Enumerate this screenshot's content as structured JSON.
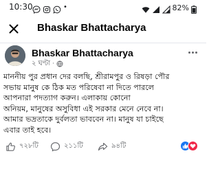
{
  "status_bar": {
    "time": "10:30",
    "separator": "•",
    "battery": "82%"
  },
  "app_bar": {
    "title": "Bhaskar Bhattacharya"
  },
  "post": {
    "author": "Bhaskar Bhattacharya",
    "time": "২ ঘণ্টা",
    "dot": "·",
    "lines": [
      "মাননীয় পুর প্রধান দের বলছি, শ্রীরামপুর ও রিষড়া পৌর",
      "সভায় মানুষ কে ঠিক মত পরিষেবা না দিতে পারলে",
      "আপনারা পদত্যাগ করুন। এলাকায় কোনো",
      "অনিয়ম, মানুষের অসুবিধা এই সরকার মেনে নেবে না।",
      "আমার ভদ্রতাকে দুর্বলতা ভাববেন না। মানুষ যা চাইছে",
      "এবার তাই হবে।"
    ]
  },
  "actions": {
    "likes": "৭২৮টি",
    "comments": "২১১টি",
    "shares": "৯৪টি"
  },
  "reactions": [
    "like",
    "love"
  ],
  "colors": {
    "like_blue": "#1877f2",
    "love_red": "#f02849",
    "icon_gray": "#65676b"
  }
}
